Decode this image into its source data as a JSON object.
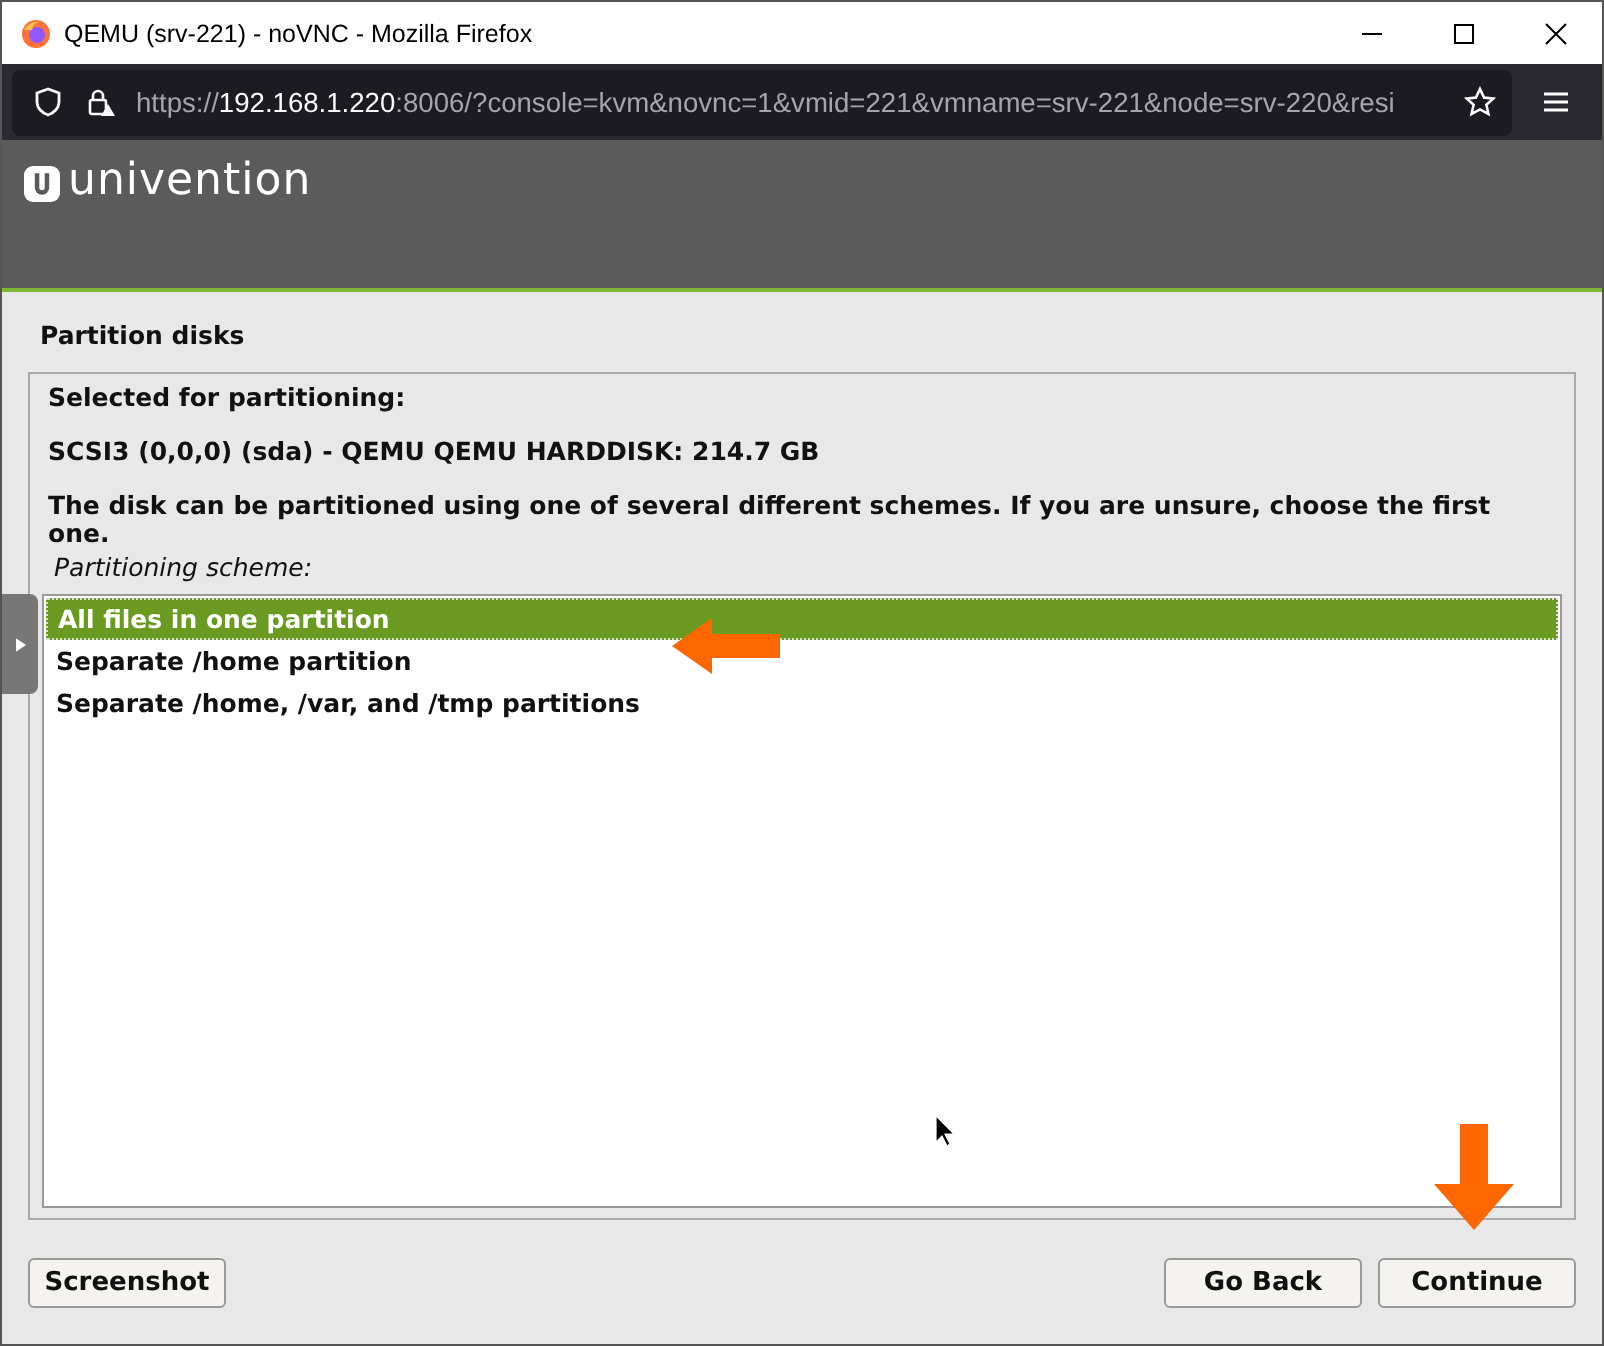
{
  "window": {
    "title": "QEMU (srv-221) - noVNC - Mozilla Firefox"
  },
  "address_bar": {
    "scheme": "https://",
    "host": "192.168.1.220",
    "rest": ":8006/?console=kvm&novnc=1&vmid=221&vmname=srv-221&node=srv-220&resi"
  },
  "installer": {
    "logo": "univention",
    "heading": "Partition disks",
    "lines": [
      {
        "kind": "label",
        "text": "Selected for partitioning:"
      },
      {
        "kind": "label",
        "text": "SCSI3 (0,0,0) (sda) - QEMU QEMU HARDDISK: 214.7 GB"
      },
      {
        "kind": "label",
        "text": "The disk can be partitioned using one of several different schemes. If you are unsure, choose the first one."
      },
      {
        "kind": "hint",
        "text": "Partitioning scheme:"
      }
    ],
    "schemes": [
      {
        "label": "All files in one partition",
        "selected": true
      },
      {
        "label": "Separate /home partition",
        "selected": false
      },
      {
        "label": "Separate /home, /var, and /tmp partitions",
        "selected": false
      }
    ],
    "left_buttons": [
      "Screenshot"
    ],
    "right_buttons": [
      "Go Back",
      "Continue"
    ]
  }
}
